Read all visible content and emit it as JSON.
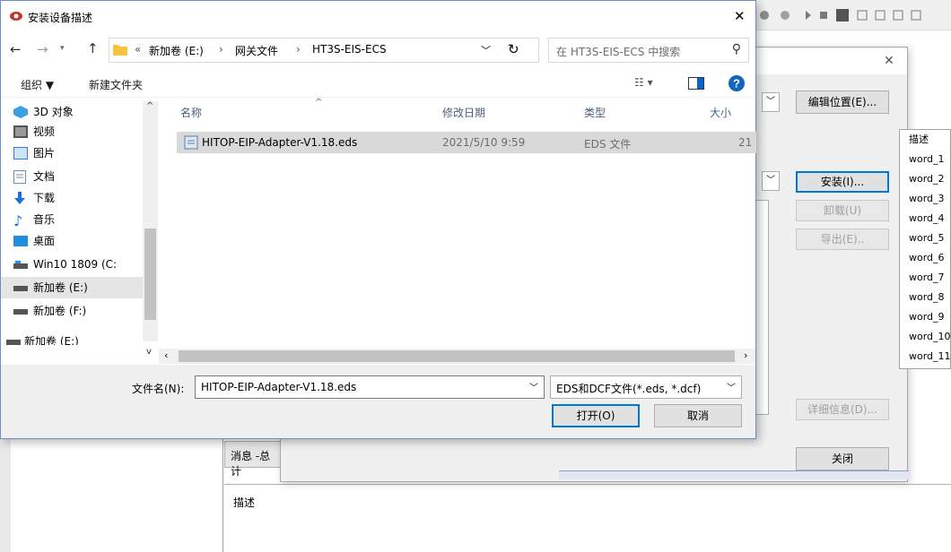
{
  "background": {
    "message_tab_label": "消息 -总计",
    "description_label": "描述",
    "vendor_list": [
      "描述",
      "word_1",
      "word_2",
      "word_3",
      "word_4",
      "word_5",
      "word_6",
      "word_7",
      "word_8",
      "word_9",
      "word_10",
      "word_11"
    ]
  },
  "install_dialog": {
    "edit_location_button": "编辑位置(E)...",
    "install_button": "安装(I)...",
    "uninstall_button": "卸载(U)",
    "export_button": "导出(E)..",
    "details_button": "详细信息(D)...",
    "close_button": "关闭"
  },
  "file_dialog": {
    "title": "安装设备描述",
    "address": {
      "overflow": "«",
      "crumbs": [
        "新加卷 (E:)",
        "网关文件",
        "HT3S-EIS-ECS"
      ]
    },
    "search_placeholder": "在 HT3S-EIS-ECS 中搜索",
    "organize_label": "组织 ▼",
    "new_folder_label": "新建文件夹",
    "tree": [
      {
        "label": "3D 对象",
        "icon": "3d-objects-icon"
      },
      {
        "label": "视频",
        "icon": "video-icon"
      },
      {
        "label": "图片",
        "icon": "pictures-icon"
      },
      {
        "label": "文档",
        "icon": "documents-icon"
      },
      {
        "label": "下载",
        "icon": "download-icon"
      },
      {
        "label": "音乐",
        "icon": "music-icon"
      },
      {
        "label": "桌面",
        "icon": "desktop-icon"
      },
      {
        "label": "Win10 1809 (C:",
        "icon": "system-drive-icon"
      },
      {
        "label": "新加卷 (E:)",
        "icon": "drive-icon",
        "selected": true
      },
      {
        "label": "新加卷 (F:)",
        "icon": "drive-icon"
      },
      {
        "label": "新加卷 (E:)",
        "icon": "drive-icon"
      }
    ],
    "columns": {
      "name": "名称",
      "modified": "修改日期",
      "type": "类型",
      "size": "大小"
    },
    "files": [
      {
        "name": "HITOP-EIP-Adapter-V1.18.eds",
        "modified": "2021/5/10 9:59",
        "type": "EDS 文件",
        "size": "21"
      }
    ],
    "filename_label": "文件名(N):",
    "filename_value": "HITOP-EIP-Adapter-V1.18.eds",
    "filter_value": "EDS和DCF文件(*.eds, *.dcf)",
    "open_button": "打开(O)",
    "cancel_button": "取消"
  }
}
